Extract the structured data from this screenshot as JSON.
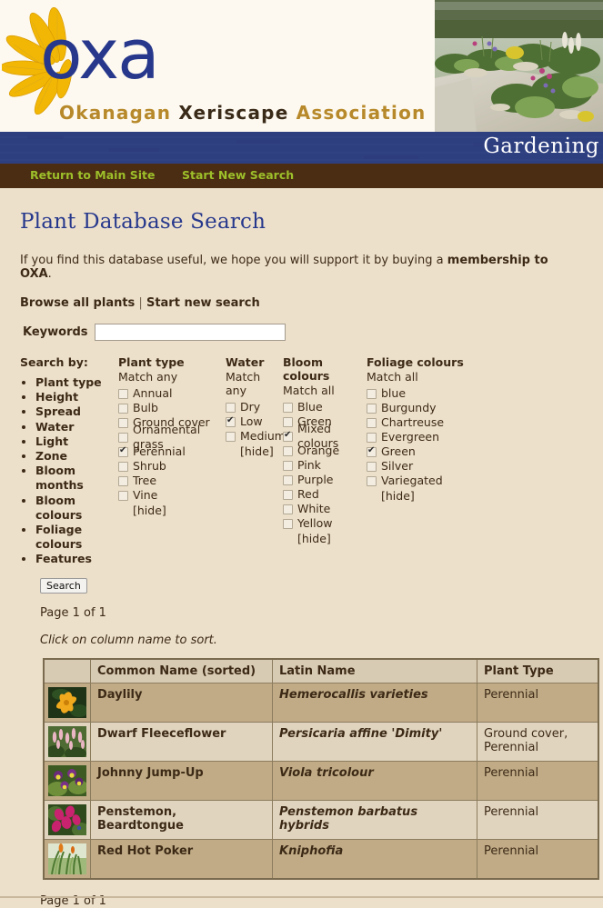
{
  "brand": {
    "logo_text": "oxa",
    "assoc_word1": "Okanagan",
    "assoc_word2": "Xeriscape",
    "assoc_word3": "Association",
    "section_label": "Gardening",
    "logo_icon": "sunflower-logo",
    "banner_icon": "xeriscape-garden-photo",
    "colors": {
      "blue": "#27388c",
      "gold": "#b7892a",
      "navbar": "#4a2d12",
      "nav_link": "#9dbf2a",
      "page_bg": "#ece0cb"
    }
  },
  "nav": {
    "items": [
      {
        "label": "Return to Main Site"
      },
      {
        "label": "Start New Search"
      }
    ]
  },
  "page": {
    "title": "Plant Database Search",
    "intro_prefix": "If you find this database useful, we hope you will support it by buying a ",
    "intro_link": "membership to OXA",
    "intro_suffix": ".",
    "quick_browse": "Browse all plants",
    "quick_sep": " | ",
    "quick_new": "Start new search",
    "page_info_top": "Page 1 of 1",
    "sort_hint": "Click on column name to sort.",
    "page_info_bottom": "Page 1 of 1"
  },
  "keywords": {
    "label": "Keywords",
    "value": "",
    "placeholder": ""
  },
  "search_by": {
    "heading": "Search by:",
    "items": [
      {
        "label": "Plant type"
      },
      {
        "label": "Height"
      },
      {
        "label": "Spread"
      },
      {
        "label": "Water"
      },
      {
        "label": "Light"
      },
      {
        "label": "Zone"
      },
      {
        "label": "Bloom months"
      },
      {
        "label": "Bloom colours"
      },
      {
        "label": "Foliage colours"
      },
      {
        "label": "Features"
      }
    ]
  },
  "filters": [
    {
      "key": "plant_type",
      "heading": "Plant type",
      "match": "Match any",
      "hide": "[hide]",
      "options": [
        {
          "label": "Annual",
          "checked": false
        },
        {
          "label": "Bulb",
          "checked": false
        },
        {
          "label": "Ground cover",
          "checked": false
        },
        {
          "label": "Ornamental grass",
          "checked": false
        },
        {
          "label": "Perennial",
          "checked": true
        },
        {
          "label": "Shrub",
          "checked": false
        },
        {
          "label": "Tree",
          "checked": false
        },
        {
          "label": "Vine",
          "checked": false
        }
      ]
    },
    {
      "key": "water",
      "heading": "Water",
      "match": "Match any",
      "hide": "[hide]",
      "options": [
        {
          "label": "Dry",
          "checked": false
        },
        {
          "label": "Low",
          "checked": true
        },
        {
          "label": "Medium",
          "checked": false
        }
      ]
    },
    {
      "key": "bloom_colours",
      "heading": "Bloom colours",
      "match": "Match all",
      "hide": "[hide]",
      "options": [
        {
          "label": "Blue",
          "checked": false
        },
        {
          "label": "Green",
          "checked": false
        },
        {
          "label": "Mixed colours",
          "checked": true
        },
        {
          "label": "Orange",
          "checked": false
        },
        {
          "label": "Pink",
          "checked": false
        },
        {
          "label": "Purple",
          "checked": false
        },
        {
          "label": "Red",
          "checked": false
        },
        {
          "label": "White",
          "checked": false
        },
        {
          "label": "Yellow",
          "checked": false
        }
      ]
    },
    {
      "key": "foliage_colours",
      "heading": "Foliage colours",
      "match": "Match all",
      "hide": "[hide]",
      "options": [
        {
          "label": "blue",
          "checked": false
        },
        {
          "label": "Burgundy",
          "checked": false
        },
        {
          "label": "Chartreuse",
          "checked": false
        },
        {
          "label": "Evergreen",
          "checked": false
        },
        {
          "label": "Green",
          "checked": true
        },
        {
          "label": "Silver",
          "checked": false
        },
        {
          "label": "Variegated",
          "checked": false
        }
      ]
    }
  ],
  "search_button": {
    "label": "Search"
  },
  "results_table": {
    "columns": [
      "",
      "Common Name (sorted)",
      "Latin Name",
      "Plant Type"
    ],
    "rows": [
      {
        "thumb": "daylily-thumb",
        "common": "Daylily",
        "latin": "Hemerocallis varieties",
        "type": "Perennial"
      },
      {
        "thumb": "dwarf-fleeceflower-thumb",
        "common": "Dwarf Fleeceflower",
        "latin": "Persicaria affine 'Dimity'",
        "type": "Ground cover, Perennial"
      },
      {
        "thumb": "johnny-jump-up-thumb",
        "common": "Johnny Jump-Up",
        "latin": "Viola tricolour",
        "type": "Perennial"
      },
      {
        "thumb": "penstemon-thumb",
        "common": "Penstemon, Beardtongue",
        "latin": "Penstemon barbatus hybrids",
        "type": "Perennial"
      },
      {
        "thumb": "red-hot-poker-thumb",
        "common": "Red Hot Poker",
        "latin": "Kniphofia",
        "type": "Perennial"
      }
    ]
  }
}
